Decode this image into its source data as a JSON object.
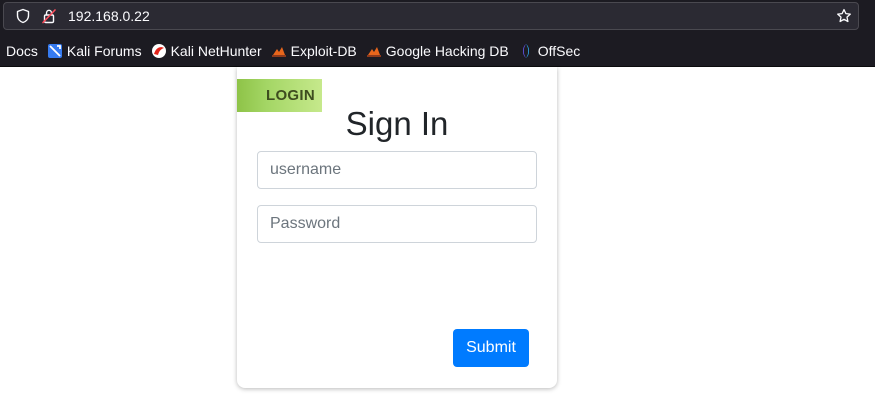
{
  "browser": {
    "url": "192.168.0.22",
    "bookmarks": [
      {
        "label": "Docs",
        "icon": "kali-docs-icon"
      },
      {
        "label": "Kali Forums",
        "icon": "kali-forums-icon"
      },
      {
        "label": "Kali NetHunter",
        "icon": "kali-nethunter-icon"
      },
      {
        "label": "Exploit-DB",
        "icon": "exploit-db-icon"
      },
      {
        "label": "Google Hacking DB",
        "icon": "google-hacking-db-icon"
      },
      {
        "label": "OffSec",
        "icon": "offsec-icon"
      }
    ]
  },
  "login": {
    "ribbon_label": "LOGIN",
    "title": "Sign In",
    "username_placeholder": "username",
    "password_placeholder": "Password",
    "submit_label": "Submit"
  },
  "colors": {
    "primary": "#007bff",
    "ribbon_green": "#a4d665",
    "browser_bg": "#1c1b22"
  }
}
